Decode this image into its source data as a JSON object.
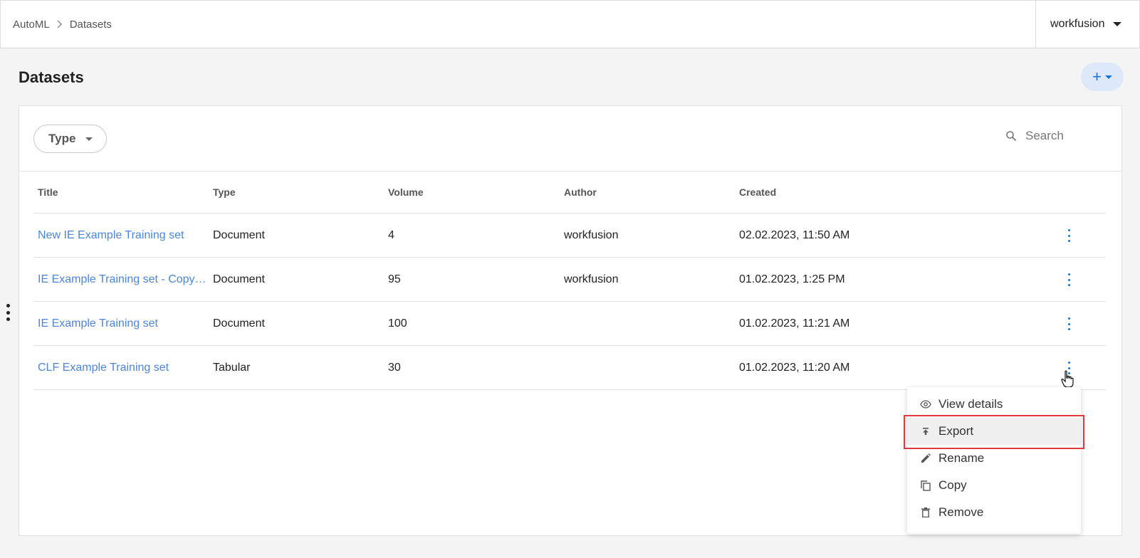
{
  "breadcrumb": {
    "root": "AutoML",
    "current": "Datasets"
  },
  "user": {
    "name": "workfusion"
  },
  "page": {
    "title": "Datasets",
    "add_label": "+"
  },
  "filters": {
    "type_label": "Type",
    "search_placeholder": "Search"
  },
  "table": {
    "columns": [
      "Title",
      "Type",
      "Volume",
      "Author",
      "Created"
    ],
    "rows": [
      {
        "title": "New IE Example Training set",
        "type": "Document",
        "volume": "4",
        "author": "workfusion",
        "created": "02.02.2023, 11:50 AM"
      },
      {
        "title": "IE Example Training set - Copy…",
        "type": "Document",
        "volume": "95",
        "author": "workfusion",
        "created": "01.02.2023, 1:25 PM"
      },
      {
        "title": "IE Example Training set",
        "type": "Document",
        "volume": "100",
        "author": "",
        "created": "01.02.2023, 11:21 AM"
      },
      {
        "title": "CLF Example Training set",
        "type": "Tabular",
        "volume": "30",
        "author": "",
        "created": "01.02.2023, 11:20 AM"
      }
    ]
  },
  "context_menu": {
    "items": [
      {
        "label": "View details",
        "icon": "eye-icon"
      },
      {
        "label": "Export",
        "icon": "export-icon",
        "highlighted": true
      },
      {
        "label": "Rename",
        "icon": "pencil-icon"
      },
      {
        "label": "Copy",
        "icon": "copy-icon"
      },
      {
        "label": "Remove",
        "icon": "trash-icon"
      }
    ]
  },
  "colors": {
    "accent": "#1f6fe0",
    "link": "#4a86e0",
    "highlight_border": "#e0393e"
  }
}
